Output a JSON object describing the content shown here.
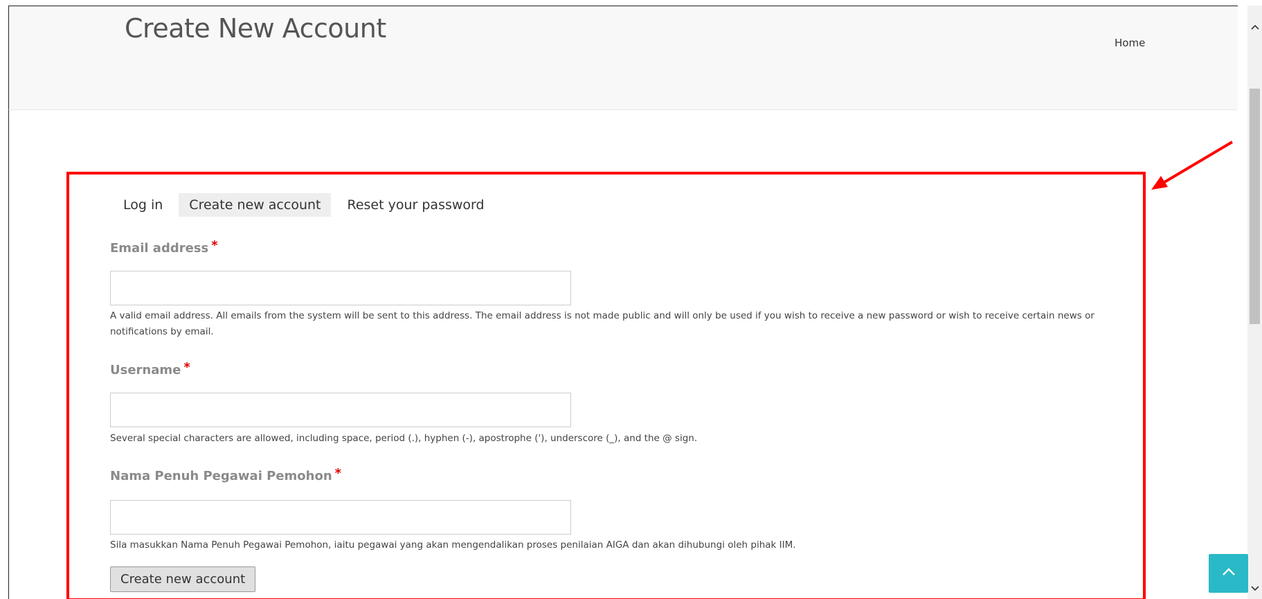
{
  "header": {
    "title": "Create New Account",
    "nav_home": "Home"
  },
  "tabs": [
    {
      "label": "Log in",
      "active": false
    },
    {
      "label": "Create new account",
      "active": true
    },
    {
      "label": "Reset your password",
      "active": false
    }
  ],
  "form": {
    "email": {
      "label": "Email address",
      "required_mark": "*",
      "value": "",
      "help": "A valid email address. All emails from the system will be sent to this address. The email address is not made public and will only be used if you wish to receive a new password or wish to receive certain news or notifications by email."
    },
    "username": {
      "label": "Username",
      "required_mark": "*",
      "value": "",
      "help": "Several special characters are allowed, including space, period (.), hyphen (-), apostrophe ('), underscore (_), and the @ sign."
    },
    "fullname": {
      "label": "Nama Penuh Pegawai Pemohon",
      "required_mark": "*",
      "value": "",
      "help": "Sila masukkan Nama Penuh Pegawai Pemohon, iaitu pegawai yang akan mengendalikan proses penilaian AIGA dan akan dihubungi oleh pihak IIM."
    },
    "submit_label": "Create new account"
  },
  "colors": {
    "highlight": "#ff0000",
    "back_to_top": "#2ab9c6",
    "required": "#e00000"
  },
  "icons": {
    "back_to_top": "chevron-up-icon",
    "scroll_up": "caret-up-icon",
    "scroll_down": "caret-down-icon",
    "annotation": "arrow-icon"
  }
}
